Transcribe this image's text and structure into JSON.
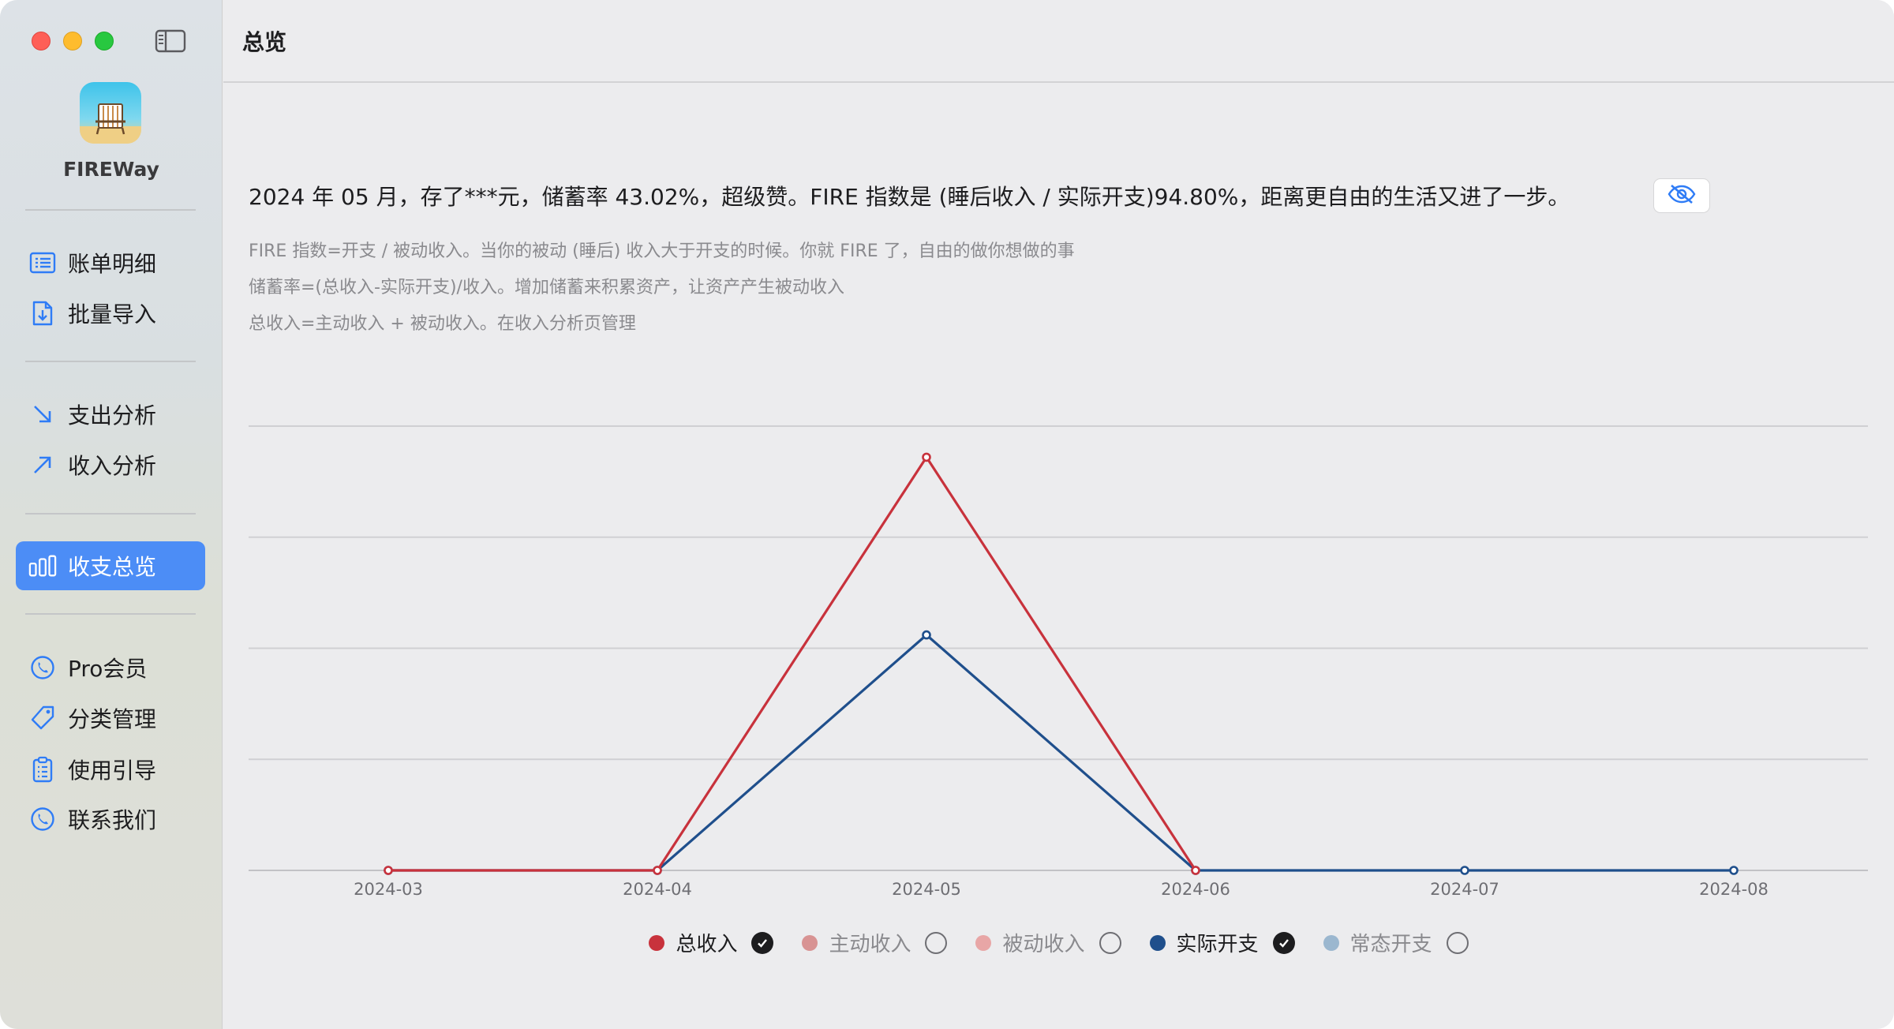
{
  "app": {
    "name": "FIREWay"
  },
  "sidebar": {
    "groups": [
      [
        {
          "label": "账单明细",
          "icon": "list-icon"
        },
        {
          "label": "批量导入",
          "icon": "import-file-icon"
        }
      ],
      [
        {
          "label": "支出分析",
          "icon": "arrow-down-right-icon"
        },
        {
          "label": "收入分析",
          "icon": "arrow-up-right-icon"
        }
      ],
      [
        {
          "label": "收支总览",
          "icon": "bar-chart-icon",
          "active": true
        }
      ],
      [
        {
          "label": "Pro会员",
          "icon": "phone-circle-icon"
        },
        {
          "label": "分类管理",
          "icon": "tag-icon"
        },
        {
          "label": "使用引导",
          "icon": "clipboard-icon"
        },
        {
          "label": "联系我们",
          "icon": "phone-circle-icon"
        }
      ]
    ]
  },
  "main": {
    "title": "总览",
    "summary": "2024 年 05 月，存了***元，储蓄率 43.02%，超级赞。FIRE 指数是 (睡后收入 / 实际开支)94.80%，距离更自由的生活又进了一步。",
    "notes": [
      "FIRE 指数=开支 / 被动收入。当你的被动 (睡后) 收入大于开支的时候。你就 FIRE 了，自由的做你想做的事",
      "储蓄率=(总收入-实际开支)/收入。增加储蓄来积累资产，让资产产生被动收入",
      "总收入=主动收入 + 被动收入。在收入分析页管理"
    ]
  },
  "colors": {
    "accent": "#4c8df6",
    "total_income": "#c8323c",
    "actual_expense": "#1f4f8c"
  },
  "chart_data": {
    "type": "line",
    "categories": [
      "2024-03",
      "2024-04",
      "2024-05",
      "2024-06",
      "2024-07",
      "2024-08"
    ],
    "series": [
      {
        "name": "总收入",
        "color": "#c8323c",
        "visible": true,
        "values": [
          0,
          0,
          0.93,
          0,
          null,
          null
        ]
      },
      {
        "name": "主动收入",
        "color": "#d89393",
        "visible": false,
        "values": []
      },
      {
        "name": "被动收入",
        "color": "#e8a6a6",
        "visible": false,
        "values": []
      },
      {
        "name": "实际开支",
        "color": "#1f4f8c",
        "visible": true,
        "values": [
          0,
          0,
          0.53,
          0,
          0,
          0
        ]
      },
      {
        "name": "常态开支",
        "color": "#9bb7cf",
        "visible": false,
        "values": []
      }
    ],
    "ylim": [
      0,
      1
    ],
    "grid": true,
    "legend": "bottom-center"
  }
}
